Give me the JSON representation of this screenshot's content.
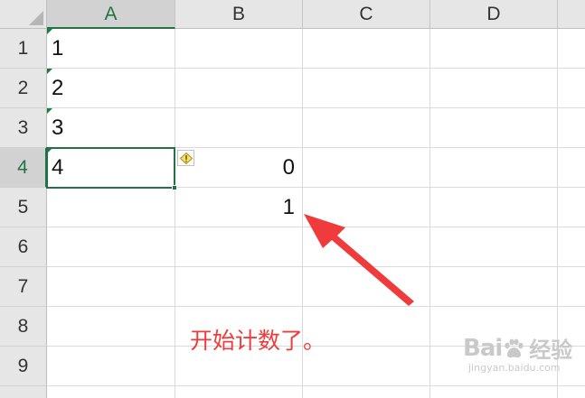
{
  "columns": [
    {
      "label": "A",
      "active": true
    },
    {
      "label": "B",
      "active": false
    },
    {
      "label": "C",
      "active": false
    },
    {
      "label": "D",
      "active": false
    }
  ],
  "rows": [
    {
      "label": "1",
      "active": false
    },
    {
      "label": "2",
      "active": false
    },
    {
      "label": "3",
      "active": false
    },
    {
      "label": "4",
      "active": true
    },
    {
      "label": "5",
      "active": false
    },
    {
      "label": "6",
      "active": false
    },
    {
      "label": "7",
      "active": false
    },
    {
      "label": "8",
      "active": false
    },
    {
      "label": "9",
      "active": false
    }
  ],
  "cells": {
    "A1": "1",
    "A2": "2",
    "A3": "3",
    "A4": "4",
    "B4": "0",
    "B5": "1"
  },
  "selected_cell": "A4",
  "annotation": {
    "text": "开始计数了。",
    "color": "#ef3b3b"
  },
  "watermark": {
    "logo_left": "Bai",
    "logo_right": "经验",
    "url": "jingyan.baidu.com"
  },
  "icons": {
    "error_smart_tag": "warning-diamond-icon",
    "arrow": "red-pointer-arrow"
  },
  "colors": {
    "accent": "#217346",
    "header_bg": "#e6e6e6",
    "gridline": "#dadada",
    "annotation": "#ef3b3b"
  }
}
